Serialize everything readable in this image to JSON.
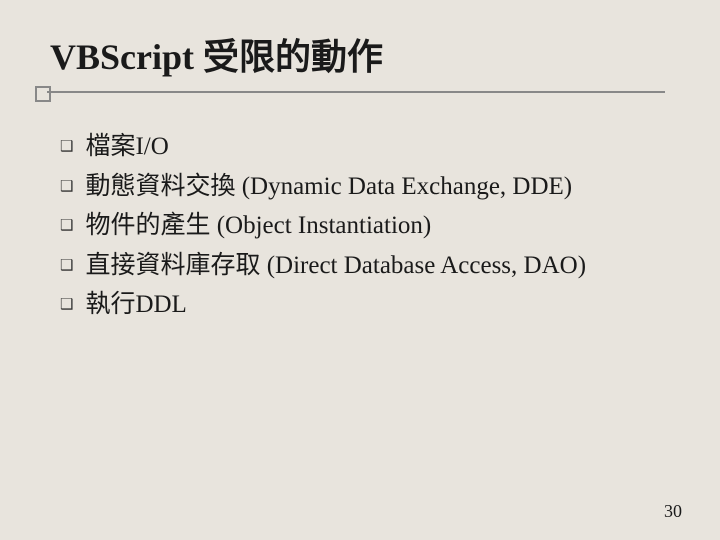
{
  "slide": {
    "title": "VBScript 受限的動作",
    "items": [
      "檔案I/O",
      "動態資料交換 (Dynamic Data Exchange, DDE)",
      "物件的產生 (Object Instantiation)",
      "直接資料庫存取 (Direct Database Access, DAO)",
      "執行DDL"
    ],
    "page_number": "30"
  }
}
